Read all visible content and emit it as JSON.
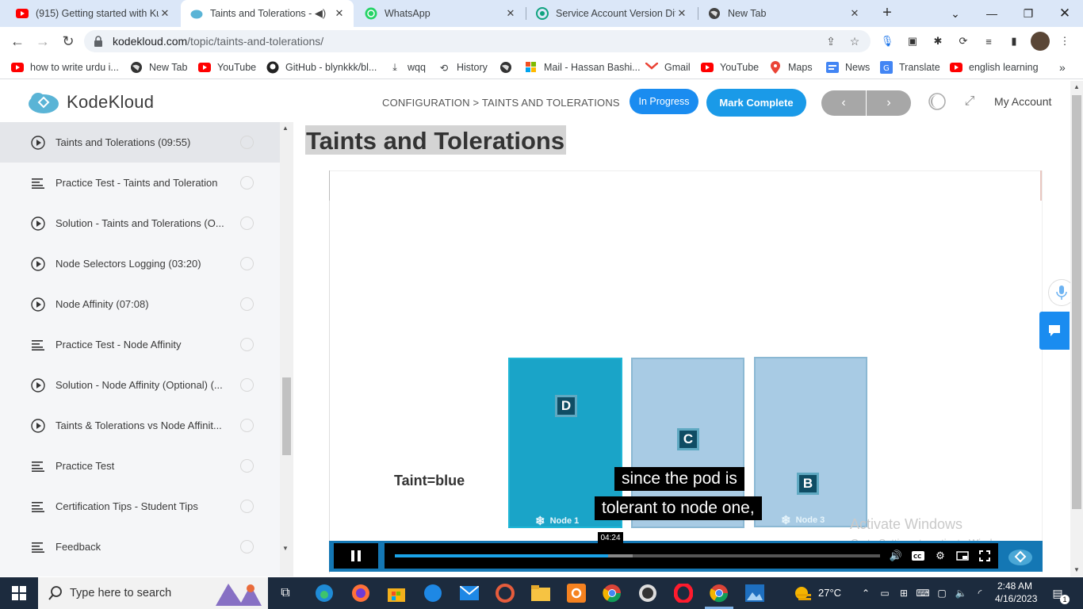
{
  "browser": {
    "tabs": [
      {
        "title": "(915) Getting started with Ku",
        "favicon": "youtube-icon",
        "active": false
      },
      {
        "title": "Taints and Tolerations - K",
        "favicon": "kodekloud-icon",
        "active": true,
        "audio": true
      },
      {
        "title": "WhatsApp",
        "favicon": "whatsapp-icon",
        "active": false
      },
      {
        "title": "Service Account Version Diffe",
        "favicon": "chatgpt-icon",
        "active": false
      },
      {
        "title": "New Tab",
        "favicon": "globe-icon",
        "active": false
      }
    ],
    "url_host": "kodekloud.com",
    "url_path": "/topic/taints-and-tolerations/",
    "bookmarks": [
      {
        "label": "how to write urdu i...",
        "icon": "youtube-icon"
      },
      {
        "label": "New Tab",
        "icon": "globe-icon"
      },
      {
        "label": "YouTube",
        "icon": "youtube-icon"
      },
      {
        "label": "GitHub - blynkkk/bl...",
        "icon": "github-icon"
      },
      {
        "label": "wqq",
        "icon": "download-icon"
      },
      {
        "label": "History",
        "icon": "history-icon"
      },
      {
        "label": "",
        "icon": "globe-icon"
      },
      {
        "label": "Mail - Hassan Bashi...",
        "icon": "microsoft-icon"
      },
      {
        "label": "Gmail",
        "icon": "gmail-icon"
      },
      {
        "label": "YouTube",
        "icon": "youtube-icon"
      },
      {
        "label": "Maps",
        "icon": "maps-icon"
      },
      {
        "label": "News",
        "icon": "news-icon"
      },
      {
        "label": "Translate",
        "icon": "translate-icon"
      },
      {
        "label": "english learning",
        "icon": "youtube-icon"
      }
    ]
  },
  "header": {
    "brand": "KodeKloud",
    "breadcrumb": "CONFIGURATION > TAINTS AND TOLERATIONS",
    "status_button": "In Progress",
    "complete_button": "Mark Complete",
    "prev_label": "‹",
    "next_label": "›",
    "account_label": "My Account"
  },
  "sidebar": {
    "items": [
      {
        "label": "Taints and Tolerations (09:55)",
        "type": "video",
        "current": true
      },
      {
        "label": "Practice Test - Taints and Toleration",
        "type": "text"
      },
      {
        "label": "Solution - Taints and Tolerations (O...",
        "type": "video"
      },
      {
        "label": "Node Selectors Logging (03:20)",
        "type": "video"
      },
      {
        "label": "Node Affinity (07:08)",
        "type": "video"
      },
      {
        "label": "Practice Test - Node Affinity",
        "type": "text"
      },
      {
        "label": "Solution - Node Affinity (Optional) (...",
        "type": "video"
      },
      {
        "label": "Taints & Tolerations vs Node Affinit...",
        "type": "video"
      },
      {
        "label": "Practice Test",
        "type": "text"
      },
      {
        "label": "Certification Tips - Student Tips",
        "type": "text"
      },
      {
        "label": "Feedback",
        "type": "text"
      }
    ]
  },
  "lesson": {
    "title": "Taints and Tolerations"
  },
  "video": {
    "slide": {
      "taint_label": "Taint=blue",
      "nodes": [
        {
          "label": "Node 1",
          "pods": [
            "D"
          ]
        },
        {
          "label": "Node 2",
          "pods": [
            "C"
          ]
        },
        {
          "label": "Node 3",
          "pods": [
            "B"
          ]
        }
      ]
    },
    "caption_line1": "since the pod is",
    "caption_line2": "tolerant to node one,",
    "hover_time": "04:24",
    "progress_fraction": 0.44,
    "buffered_fraction": 0.49,
    "state": "playing"
  },
  "os_watermark": {
    "line1": "Activate Windows",
    "line2": "Go to Settings to activate Windows."
  },
  "taskbar": {
    "search_placeholder": "Type here to search",
    "weather": "27°C",
    "time": "2:48 AM",
    "date": "4/16/2023",
    "notification_count": "1"
  },
  "colors": {
    "accent": "#1a8cf0",
    "node_tainted": "#1aa4c8",
    "node_plain": "#a8cbe4",
    "video_bar": "#1477b4"
  }
}
